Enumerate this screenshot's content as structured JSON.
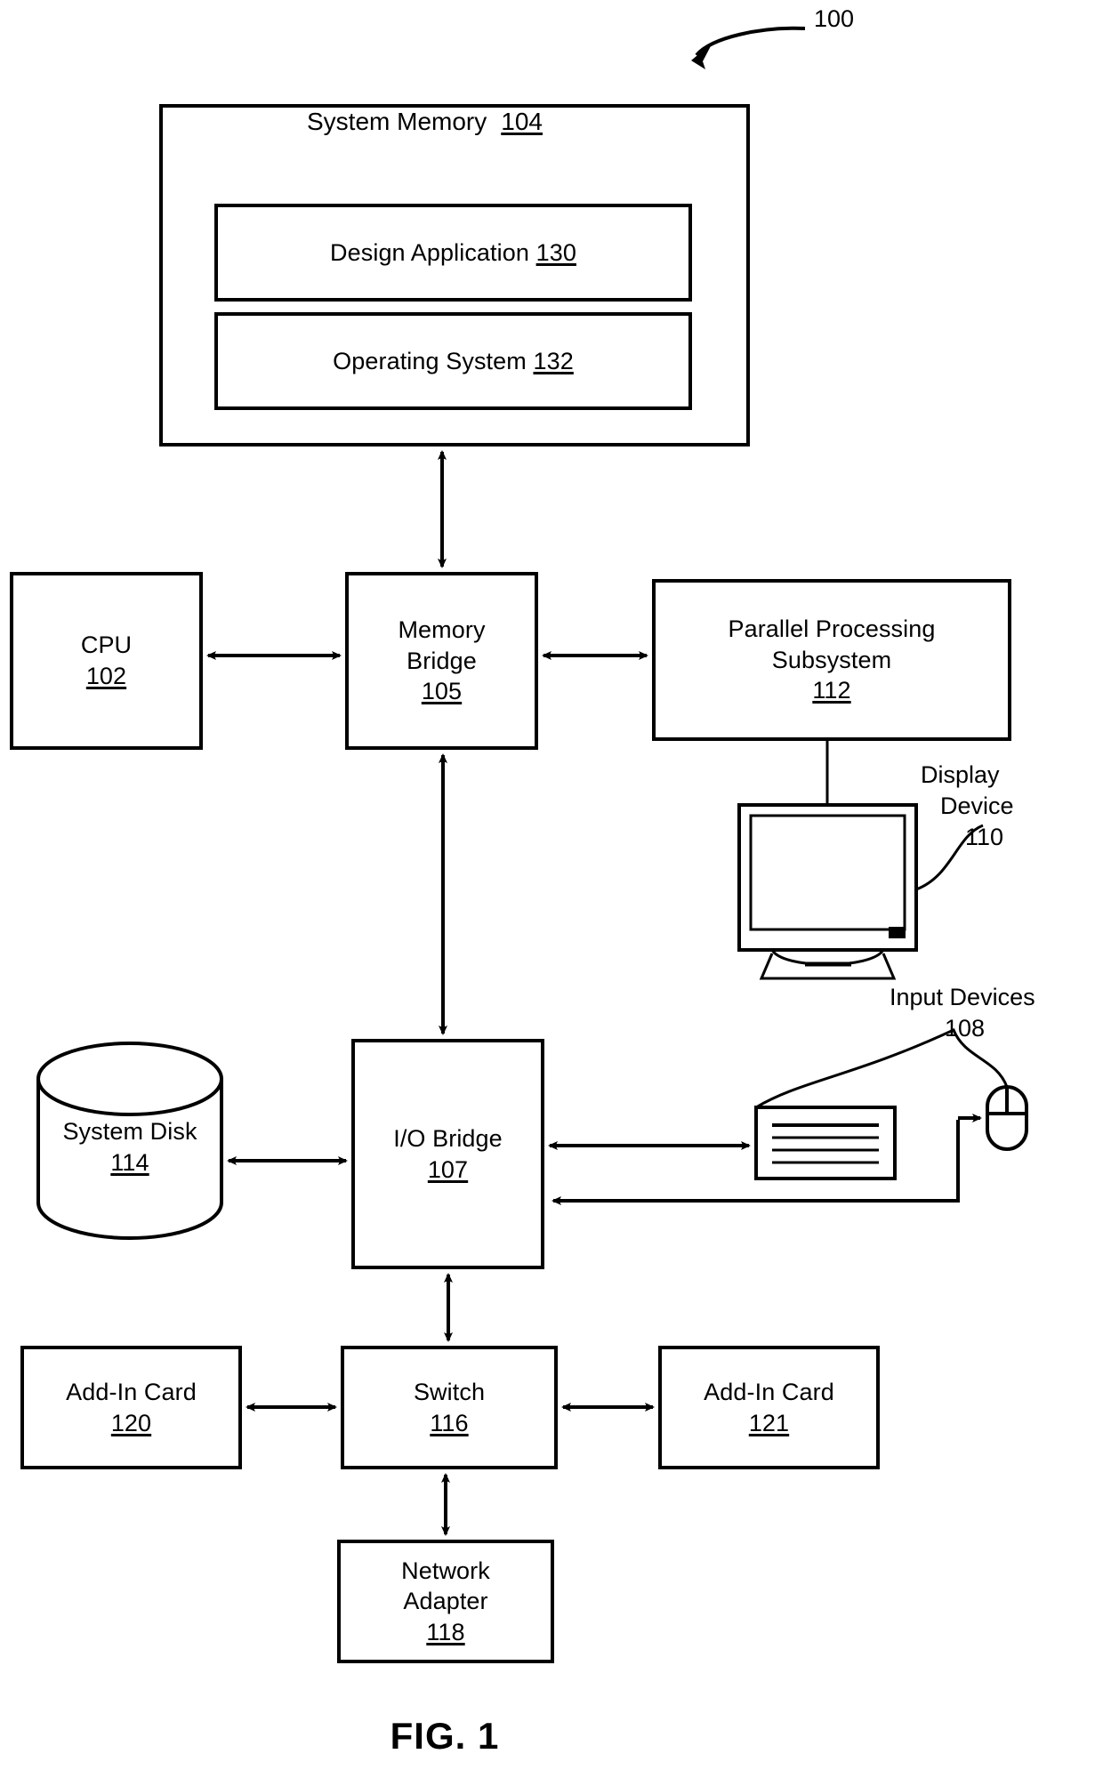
{
  "figure": {
    "caption": "FIG. 1",
    "system_ref": "100"
  },
  "blocks": {
    "system_memory": {
      "label": "System Memory",
      "ref": "104"
    },
    "design_application": {
      "label": "Design Application",
      "ref": "130"
    },
    "operating_system": {
      "label": "Operating System",
      "ref": "132"
    },
    "cpu": {
      "label": "CPU",
      "ref": "102"
    },
    "memory_bridge": {
      "label_line1": "Memory",
      "label_line2": "Bridge",
      "ref": "105"
    },
    "parallel_processing_subsystem": {
      "label_line1": "Parallel Processing",
      "label_line2": "Subsystem",
      "ref": "112"
    },
    "display_device": {
      "label_line1": "Display",
      "label_line2": "Device",
      "ref": "110"
    },
    "input_devices": {
      "label": "Input Devices",
      "ref": "108"
    },
    "system_disk": {
      "label": "System Disk",
      "ref": "114"
    },
    "io_bridge": {
      "label": "I/O Bridge",
      "ref": "107"
    },
    "add_in_card_left": {
      "label": "Add-In Card",
      "ref": "120"
    },
    "switch": {
      "label": "Switch",
      "ref": "116"
    },
    "add_in_card_right": {
      "label": "Add-In Card",
      "ref": "121"
    },
    "network_adapter": {
      "label_line1": "Network",
      "label_line2": "Adapter",
      "ref": "118"
    }
  },
  "colors": {
    "stroke": "#000000",
    "background": "#ffffff"
  }
}
